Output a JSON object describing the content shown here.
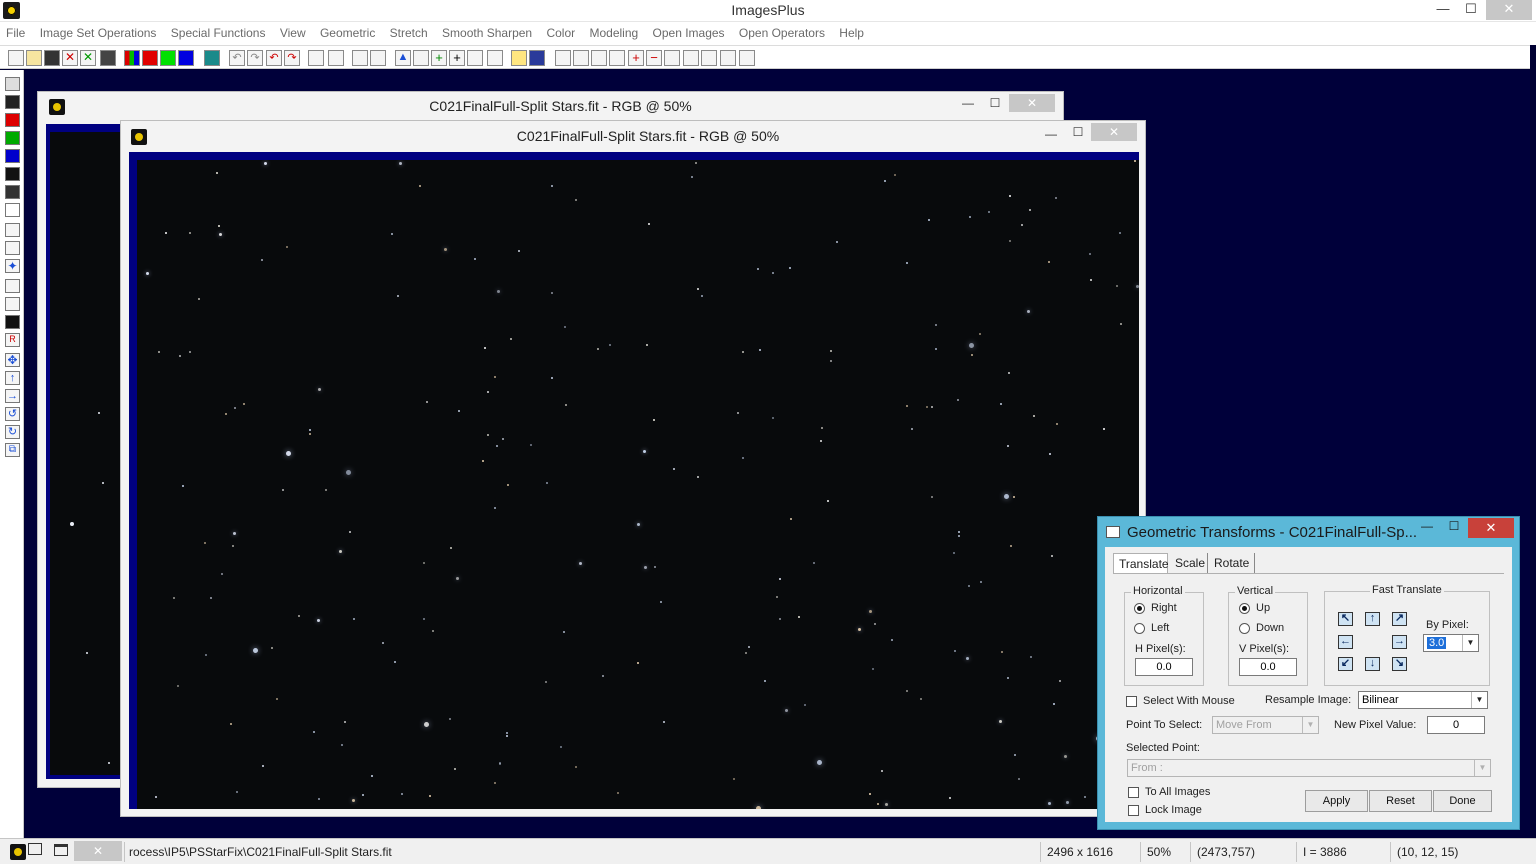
{
  "app": {
    "title": "ImagesPlus",
    "minimize": "—",
    "maximize": "☐",
    "close": "✕"
  },
  "menu": [
    "File",
    "Image Set Operations",
    "Special Functions",
    "View",
    "Geometric",
    "Stretch",
    "Smooth Sharpen",
    "Color",
    "Modeling",
    "Open Images",
    "Open Operators",
    "Help"
  ],
  "windows": {
    "back": {
      "title": "C021FinalFull-Split Stars.fit - RGB @ 50%"
    },
    "front": {
      "title": "C021FinalFull-Split Stars.fit - RGB @ 50%"
    }
  },
  "dialog": {
    "title": "Geometric Transforms - C021FinalFull-Sp...",
    "tabs": [
      "Translate",
      "Scale",
      "Rotate"
    ],
    "horizontal": {
      "label": "Horizontal",
      "right": "Right",
      "left": "Left",
      "selected": "Right",
      "h_pixels_label": "H Pixel(s):",
      "h_pixels_value": "0.0"
    },
    "vertical": {
      "label": "Vertical",
      "up": "Up",
      "down": "Down",
      "selected": "Up",
      "v_pixels_label": "V Pixel(s):",
      "v_pixels_value": "0.0"
    },
    "fast_translate": {
      "label": "Fast Translate",
      "by_pixel_label": "By Pixel:",
      "by_pixel_value": "3.0",
      "arrows": [
        "↖",
        "↑",
        "↗",
        "←",
        "→",
        "↙",
        "↓",
        "↘"
      ]
    },
    "select_with_mouse": "Select With Mouse",
    "resample_label": "Resample Image:",
    "resample_value": "Bilinear",
    "point_to_select_label": "Point To Select:",
    "point_to_select_value": "Move From",
    "new_pixel_label": "New Pixel Value:",
    "new_pixel_value": "0",
    "selected_point_label": "Selected Point:",
    "selected_point_value": "From :",
    "to_all_images": "To All Images",
    "lock_image": "Lock Image",
    "apply": "Apply",
    "reset": "Reset",
    "done": "Done"
  },
  "status": {
    "path": "rocess\\IP5\\PSStarFix\\C021FinalFull-Split Stars.fit",
    "dimensions": "2496 x 1616",
    "zoom": "50%",
    "coords": "(2473,757)",
    "intensity": "I = 3886",
    "rgb": "(10, 12, 15)"
  },
  "colors": {
    "mdi_background": "#00003a",
    "image_frame": "#000080",
    "dialog_border": "#5bb8d8",
    "close_red": "#c8413a"
  }
}
